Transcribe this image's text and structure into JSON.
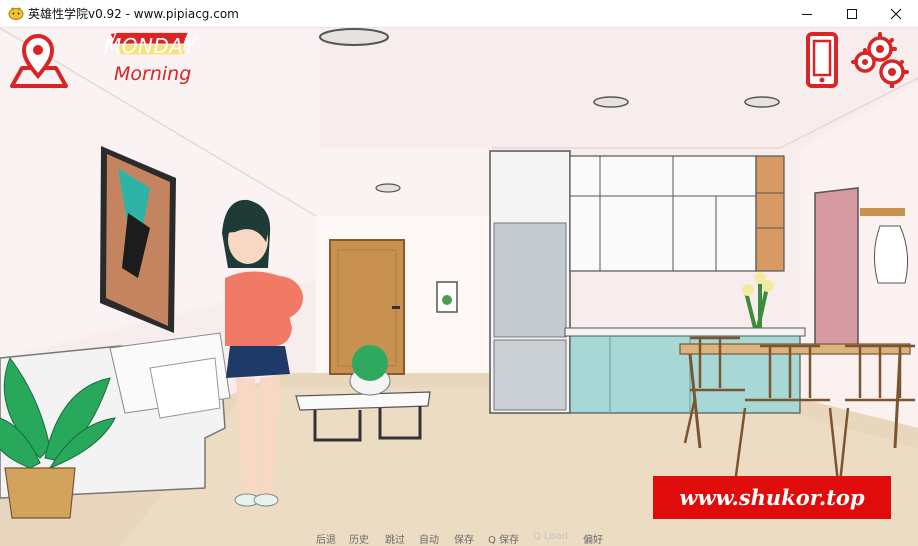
{
  "window": {
    "title": "英雄性学院v0.92 - www.pipiacg.com",
    "controls": [
      "minimize-icon",
      "maximize-icon",
      "close-icon"
    ]
  },
  "hud": {
    "day": "MONDAY",
    "time_of_day": "Morning",
    "icons": [
      "map-pin-icon",
      "phone-icon",
      "settings-gears-icon"
    ],
    "accent_color": "#d92525"
  },
  "quick_menu": {
    "items": [
      {
        "label": "后退",
        "enabled": true
      },
      {
        "label": "历史",
        "enabled": true
      },
      {
        "label": "跳过",
        "enabled": true
      },
      {
        "label": "自动",
        "enabled": true
      },
      {
        "label": "保存",
        "enabled": true
      },
      {
        "label": "Q 保存",
        "enabled": true
      },
      {
        "label": "Q Load",
        "enabled": false
      },
      {
        "label": "偏好",
        "enabled": true
      }
    ]
  },
  "watermark": {
    "text": "www.shukor.top"
  }
}
